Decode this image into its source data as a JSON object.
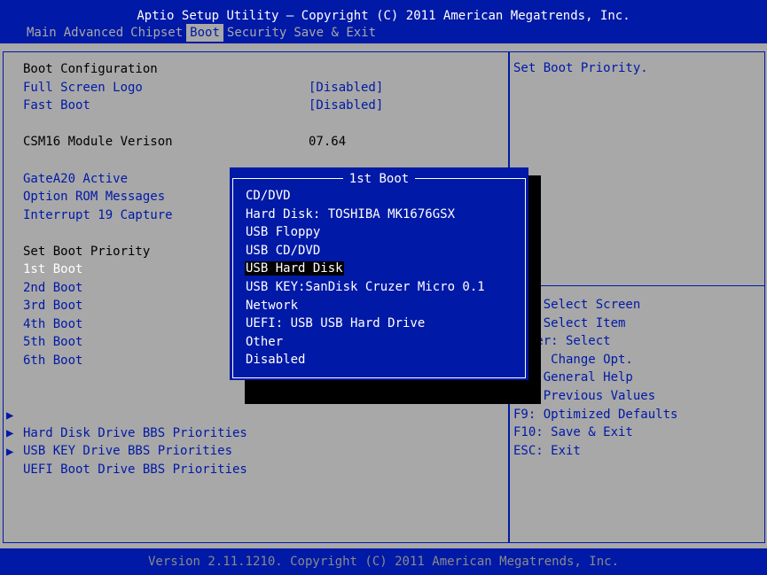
{
  "header": {
    "title": "Aptio Setup Utility – Copyright (C) 2011 American Megatrends, Inc.",
    "tabs": [
      "Main",
      "Advanced",
      "Chipset",
      "Boot",
      "Security",
      "Save & Exit"
    ],
    "active_tab": "Boot"
  },
  "boot": {
    "section_title": "Boot Configuration",
    "full_screen_logo": {
      "label": "Full Screen Logo",
      "value": "[Disabled]"
    },
    "fast_boot": {
      "label": "Fast Boot",
      "value": "[Disabled]"
    },
    "csm16": {
      "label": "CSM16 Module Verison",
      "value": "07.64"
    },
    "gatea20": {
      "label": "GateA20 Active"
    },
    "option_rom": {
      "label": "Option ROM Messages"
    },
    "int19": {
      "label": "Interrupt 19 Capture"
    },
    "priority_title": "Set Boot Priority",
    "boot_order": [
      "1st Boot",
      "2nd Boot",
      "3rd Boot",
      "4th Boot",
      "5th Boot",
      "6th Boot"
    ],
    "submenus": [
      "Hard Disk Drive BBS Priorities",
      "USB KEY Drive BBS Priorities",
      "UEFI Boot Drive BBS Priorities"
    ],
    "submenu_arrow": "▶"
  },
  "help": {
    "text": "Set Boot Priority.",
    "keys": [
      "→←: Select Screen",
      "↑↓: Select Item",
      "Enter: Select",
      "+/-: Change Opt.",
      "F1: General Help",
      "F2: Previous Values",
      "F9: Optimized Defaults",
      "F10: Save & Exit",
      "ESC: Exit"
    ]
  },
  "popup": {
    "title": "1st Boot",
    "options": [
      "CD/DVD",
      "Hard Disk: TOSHIBA MK1676GSX",
      "USB Floppy",
      "USB CD/DVD",
      "USB Hard Disk",
      "USB KEY:SanDisk Cruzer Micro 0.1",
      "Network",
      "UEFI: USB USB Hard Drive",
      "Other",
      "Disabled"
    ],
    "selected_index": 4
  },
  "footer": {
    "text": "Version 2.11.1210. Copyright (C) 2011 American Megatrends, Inc."
  },
  "colors": {
    "bios_blue": "#0019a6",
    "bios_gray": "#a8a8a8",
    "white": "#ffffff",
    "black": "#000000"
  }
}
